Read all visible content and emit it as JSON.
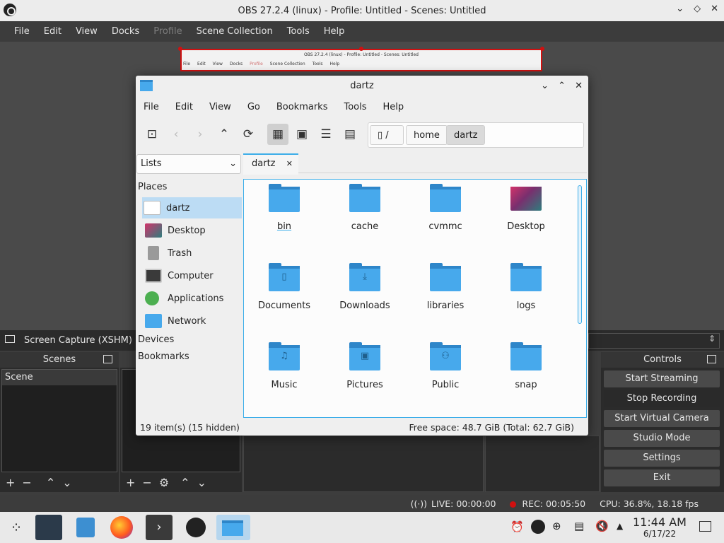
{
  "obs": {
    "title": "OBS 27.2.4 (linux) - Profile: Untitled - Scenes: Untitled",
    "window_controls": [
      "chevron-down",
      "restore",
      "close"
    ],
    "menu": [
      "File",
      "Edit",
      "View",
      "Docks",
      "Profile",
      "Scene Collection",
      "Tools",
      "Help"
    ],
    "preview_mini": {
      "title": "OBS 27.2.4 (linux) - Profile: Untitled - Scenes: Untitled",
      "menu": [
        "File",
        "Edit",
        "View",
        "Docks",
        "Profile",
        "Scene Collection",
        "Tools",
        "Help"
      ]
    },
    "source_title": "Screen Capture (XSHM)",
    "scenes_header": "Scenes",
    "scene_items": [
      "Scene"
    ],
    "controls_header": "Controls",
    "controls": [
      "Start Streaming",
      "Stop Recording",
      "Start Virtual Camera",
      "Studio Mode",
      "Settings",
      "Exit"
    ],
    "status": {
      "live": "LIVE: 00:00:00",
      "rec": "REC: 00:05:50",
      "cpu": "CPU: 36.8%, 18.18 fps"
    },
    "colors": {
      "accent": "#d01010",
      "dark_bg": "#3c3c3c"
    }
  },
  "dolphin": {
    "title": "dartz",
    "menu": [
      "File",
      "Edit",
      "View",
      "Go",
      "Bookmarks",
      "Tools",
      "Help"
    ],
    "breadcrumb": [
      "/",
      "home",
      "dartz"
    ],
    "view_selector": "Lists",
    "tab": "dartz",
    "places_header": "Places",
    "places": [
      "dartz",
      "Desktop",
      "Trash",
      "Computer",
      "Applications",
      "Network"
    ],
    "devices_header": "Devices",
    "bookmarks_header": "Bookmarks",
    "items": [
      "bin",
      "cache",
      "cvmmc",
      "Desktop",
      "Documents",
      "Downloads",
      "libraries",
      "logs",
      "Music",
      "Pictures",
      "Public",
      "snap"
    ],
    "status_left": "19 item(s) (15 hidden)",
    "status_right": "Free space: 48.7 GiB (Total: 62.7 GiB)",
    "colors": {
      "accent": "#3daee9",
      "folder": "#47a9ec"
    }
  },
  "taskbar": {
    "time": "11:44 AM",
    "date": "6/17/22"
  }
}
